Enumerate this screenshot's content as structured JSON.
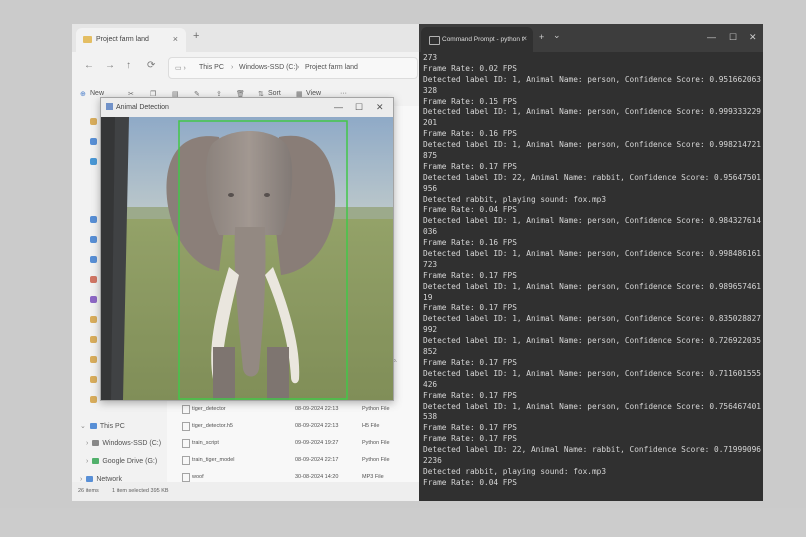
{
  "explorer": {
    "tab_title": "Project farm land",
    "tab_close": "×",
    "new_tab": "+",
    "nav": {
      "back": "←",
      "forward": "→",
      "up": "↑",
      "refresh": "⟳"
    },
    "breadcrumbs": [
      "This PC",
      "Windows-SSD (C:)",
      "Project farm land"
    ],
    "toolbar": {
      "new": "New",
      "sort": "Sort",
      "view": "View",
      "more": "···"
    },
    "sidebar": [
      {
        "label": "This PC",
        "color": "#3c7fd6"
      },
      {
        "label": "Windows-SSD (C:)",
        "color": "#777777"
      },
      {
        "label": "Google Drive (G:)",
        "color": "#34a853"
      },
      {
        "label": "Network",
        "color": "#3c7fd6"
      }
    ],
    "files": [
      {
        "name": "tiger_detector",
        "date": "08-09-2024 22:13",
        "type": "Python File",
        "selected": false
      },
      {
        "name": "tiger_detector.h5",
        "date": "08-09-2024 22:13",
        "type": "H5 File",
        "selected": false
      },
      {
        "name": "train_script",
        "date": "09-09-2024 19:27",
        "type": "Python File",
        "selected": false
      },
      {
        "name": "train_tiger_model",
        "date": "08-09-2024 22:17",
        "type": "Python File",
        "selected": false
      },
      {
        "name": "woof",
        "date": "30-08-2024 14:20",
        "type": "MP3 File",
        "selected": false
      }
    ],
    "partial_text": "Cod Co.",
    "status": {
      "items": "26 items",
      "selected": "1 item selected  395 KB"
    }
  },
  "detect_window": {
    "title": "Animal Detection",
    "minimize": "—",
    "maximize": "☐",
    "close": "✕",
    "box_color": "#22c42a"
  },
  "terminal": {
    "tab_title": "Command Prompt - python  t",
    "tab_close": "×",
    "new_tab": "+",
    "dropdown": "⌄",
    "minimize": "—",
    "maximize": "☐",
    "close": "✕",
    "lines": [
      "273",
      "Frame Rate: 0.02 FPS",
      "Detected label ID: 1, Animal Name: person, Confidence Score: 0.9516620635986",
      "328",
      "Frame Rate: 0.15 FPS",
      "Detected label ID: 1, Animal Name: person, Confidence Score: 0.9993332293968",
      "201",
      "Frame Rate: 0.16 FPS",
      "Detected label ID: 1, Animal Name: person, Confidence Score: 0.9982147216796",
      "875",
      "Frame Rate: 0.17 FPS",
      "Detected label ID: 22, Animal Name: rabbit, Confidence Score: 0.956475019454",
      "956",
      "Detected rabbit, playing sound: fox.mp3",
      "Frame Rate: 0.04 FPS",
      "Detected label ID: 1, Animal Name: person, Confidence Score: 0.9843276143074",
      "036",
      "Frame Rate: 0.16 FPS",
      "Detected label ID: 1, Animal Name: person, Confidence Score: 0.9984861611628",
      "723",
      "Frame Rate: 0.17 FPS",
      "Detected label ID: 1, Animal Name: person, Confidence Score: 0.9896574616432",
      "19",
      "Frame Rate: 0.17 FPS",
      "Detected label ID: 1, Animal Name: person, Confidence Score: 0.8350288271903",
      "992",
      "Detected label ID: 1, Animal Name: person, Confidence Score: 0.7269220352172",
      "852",
      "Frame Rate: 0.17 FPS",
      "Detected label ID: 1, Animal Name: person, Confidence Score: 0.7116015553474",
      "426",
      "Frame Rate: 0.17 FPS",
      "Detected label ID: 1, Animal Name: person, Confidence Score: 0.7564674019813",
      "538",
      "Frame Rate: 0.17 FPS",
      "Frame Rate: 0.17 FPS",
      "Detected label ID: 22, Animal Name: rabbit, Confidence Score: 0.719990968704",
      "2236",
      "Detected rabbit, playing sound: fox.mp3",
      "Frame Rate: 0.04 FPS"
    ]
  }
}
